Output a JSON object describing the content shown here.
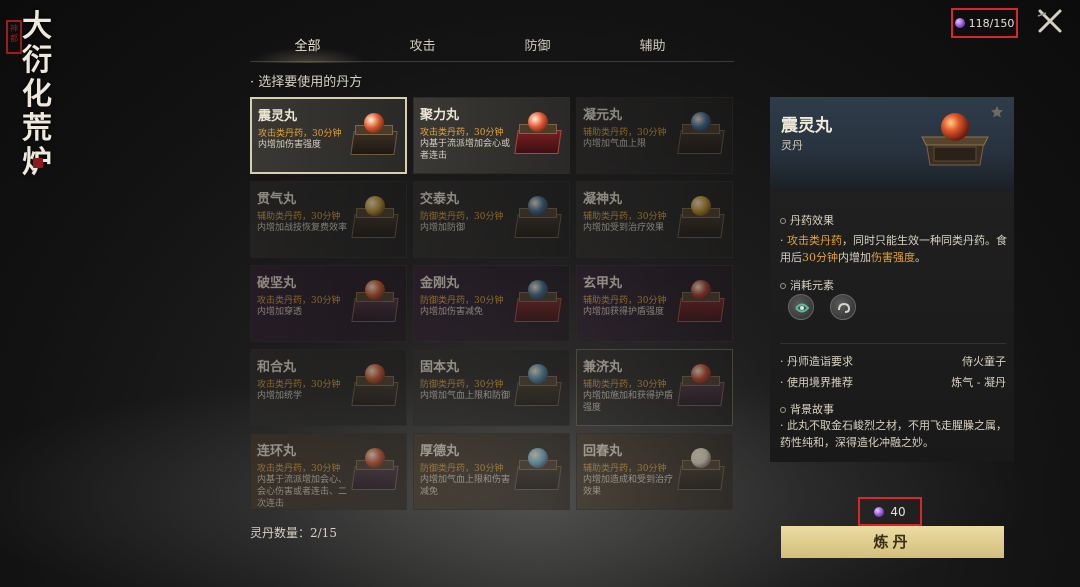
{
  "logo": {
    "title_chars": [
      "大",
      "衍",
      "化",
      "荒",
      "炉"
    ],
    "seal_text": "神都"
  },
  "currency": {
    "value": "118/150",
    "icon": "gem-icon",
    "color": "#8c4fd1"
  },
  "tabs": [
    "全部",
    "攻击",
    "防御",
    "辅助"
  ],
  "section_title": "· 选择要使用的丹方",
  "cards": [
    {
      "name": "震灵丸",
      "type": "攻击类丹药，30分钟",
      "desc": "内增加伤害强度",
      "pill_color": "#d9552a",
      "box": "brown",
      "state": "selected"
    },
    {
      "name": "聚力丸",
      "type": "攻击类丹药，30分钟",
      "desc": "内基于流派增加会心或者连击",
      "pill_color": "#e0522f",
      "box": "red",
      "state": "bright"
    },
    {
      "name": "凝元丸",
      "type": "辅助类丹药，30分钟",
      "desc": "内增加气血上限",
      "pill_color": "#3e6fa0",
      "box": "brown",
      "state": "dim"
    },
    {
      "name": "贯气丸",
      "type": "辅助类丹药，30分钟",
      "desc": "内增加战技恢复费效率",
      "pill_color": "#c89a2a",
      "box": "brown",
      "state": "dim"
    },
    {
      "name": "交泰丸",
      "type": "防御类丹药，30分钟",
      "desc": "内增加防御",
      "pill_color": "#3b6d93",
      "box": "brown",
      "state": "dim"
    },
    {
      "name": "凝神丸",
      "type": "辅助类丹药，30分钟",
      "desc": "内增加受到治疗效果",
      "pill_color": "#c89a2a",
      "box": "brown",
      "state": "dim"
    },
    {
      "name": "破坚丸",
      "type": "攻击类丹药，30分钟",
      "desc": "内增加穿透",
      "pill_color": "#d9552a",
      "box": "purple",
      "state": "dim-purple"
    },
    {
      "name": "金刚丸",
      "type": "防御类丹药，30分钟",
      "desc": "内增加伤害减免",
      "pill_color": "#3b6d93",
      "box": "red",
      "state": "dim-purple"
    },
    {
      "name": "玄甲丸",
      "type": "辅助类丹药，30分钟",
      "desc": "内增加获得护盾强度",
      "pill_color": "#b03a2a",
      "box": "red",
      "state": "dim-purple"
    },
    {
      "name": "和合丸",
      "type": "攻击类丹药，30分钟",
      "desc": "内增加统学",
      "pill_color": "#d9552a",
      "box": "brown",
      "state": "dim"
    },
    {
      "name": "固本丸",
      "type": "防御类丹药，30分钟",
      "desc": "内增加气血上限和防御",
      "pill_color": "#4f8fb0",
      "box": "brown",
      "state": "dim"
    },
    {
      "name": "兼济丸",
      "type": "辅助类丹药，30分钟",
      "desc": "内增加施加和获得护盾强度",
      "pill_color": "#c8452a",
      "box": "purple",
      "state": "dim-bordered"
    },
    {
      "name": "连环丸",
      "type": "攻击类丹药，30分钟",
      "desc": "内基于流派增加会心、会心伤害或者连击、二次连击",
      "pill_color": "#d9552a",
      "box": "purple",
      "state": "dim-gold"
    },
    {
      "name": "厚德丸",
      "type": "防御类丹药，30分钟",
      "desc": "内增加气血上限和伤害减免",
      "pill_color": "#6fb6d6",
      "box": "brown",
      "state": "dim-gold"
    },
    {
      "name": "回春丸",
      "type": "辅助类丹药，30分钟",
      "desc": "内增加造成和受到治疗效果",
      "pill_color": "#e8e0c8",
      "box": "brown",
      "state": "dim-gold"
    }
  ],
  "detail": {
    "name": "震灵丸",
    "category": "灵丹",
    "effect_label": "丹药效果",
    "effect_prefix": "· ",
    "effect_type": "攻击类丹药",
    "effect_mid": "，同时只能生效一种同类丹药。食用后",
    "effect_time": "30分钟",
    "effect_mid2": "内增加",
    "effect_stat": "伤害强度",
    "effect_end": "。",
    "elements_label": "消耗元素",
    "requirement_label": "· 丹师造诣要求",
    "requirement_value": "侍火童子",
    "realm_label": "· 使用境界推荐",
    "realm_value": "炼气 - 凝丹",
    "story_label": "背景故事",
    "story_text": "· 此丸不取金石峻烈之材，不用飞走腥臊之属，药性纯和，深得造化冲融之妙。"
  },
  "pill_count": "灵丹数量：2/15",
  "cost": {
    "value": "40",
    "icon": "gem-icon"
  },
  "refine_button": "炼丹"
}
